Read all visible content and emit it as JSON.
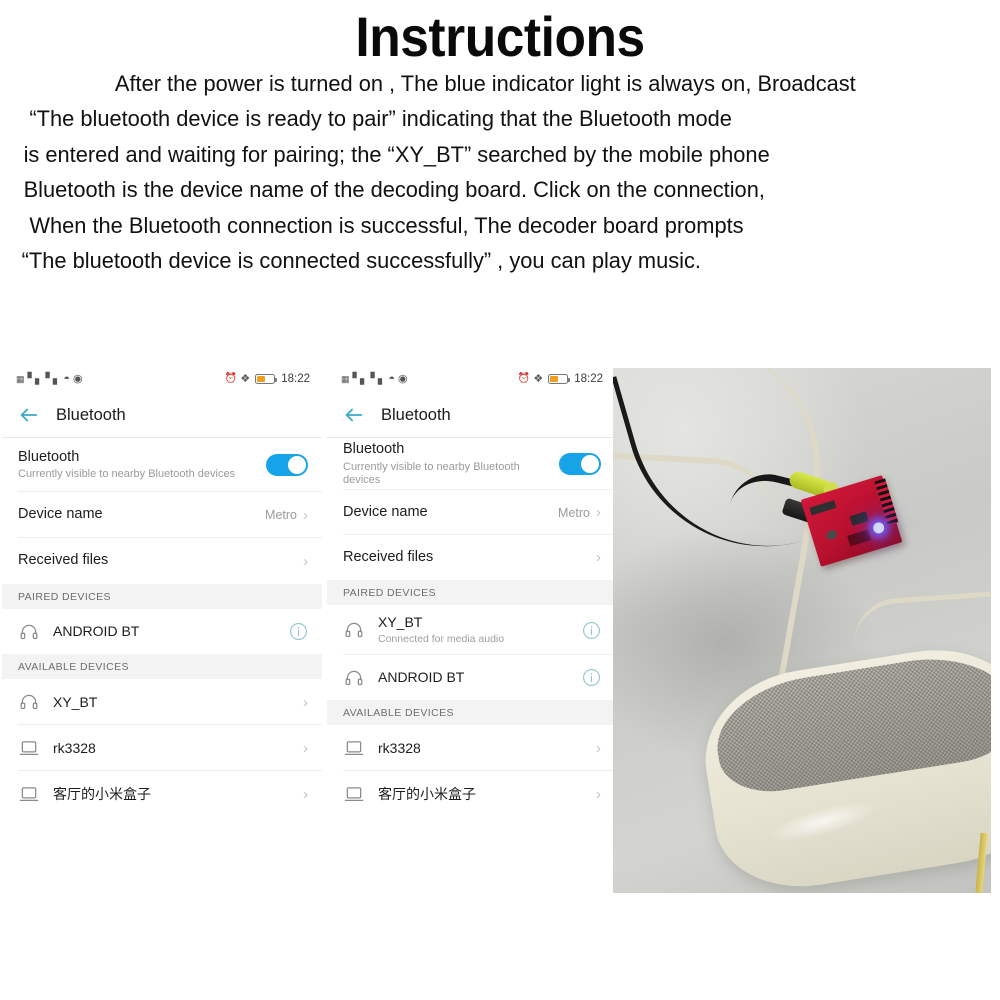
{
  "instructions": {
    "title": "Instructions",
    "lines": [
      "After the power is turned on , The blue indicator light is always on, Broadcast",
      "“The bluetooth device is  ready to pair”   indicating that the Bluetooth mode",
      "is entered and waiting for pairing; the   “XY_BT”   searched by the mobile phone",
      "Bluetooth is the device name of the decoding board. Click on the connection,",
      "When the Bluetooth connection is successful, The decoder board prompts",
      "“The bluetooth device is connected successfully” , you can play music."
    ]
  },
  "colors": {
    "toggle_on": "#17a3e8",
    "back_arrow": "#3aa9c9",
    "info_icon": "#8fc4cc",
    "battery_fill": "#f0a020",
    "section_bg": "#f3f3f3",
    "board_red": "#c8142f",
    "led_blue": "#6e5aff"
  },
  "phone1": {
    "statusbar": {
      "icons_left": [
        "sim-card-icon",
        "signal-bars-icon",
        "signal-bars-icon",
        "wifi-icon",
        "eye-icon"
      ],
      "icons_right": [
        "alarm-clock-icon",
        "bluetooth-icon",
        "battery-icon"
      ],
      "time": "18:22"
    },
    "appbar": {
      "back": "back-arrow-icon",
      "title": "Bluetooth"
    },
    "bluetooth_row": {
      "title": "Bluetooth",
      "subtitle": "Currently visible to nearby Bluetooth devices",
      "toggle_state": "on"
    },
    "device_name_row": {
      "title": "Device name",
      "value": "Metro",
      "chevron": "›"
    },
    "received_files_row": {
      "title": "Received files",
      "chevron": "›"
    },
    "paired_header": "PAIRED DEVICES",
    "paired_devices": [
      {
        "icon": "headphones-icon",
        "name": "ANDROID BT",
        "subtitle": "",
        "trailing": "info-icon"
      }
    ],
    "available_header": "AVAILABLE DEVICES",
    "available_devices": [
      {
        "icon": "headphones-icon",
        "name": "XY_BT",
        "trailing": "chevron-right-icon"
      },
      {
        "icon": "laptop-icon",
        "name": "rk3328",
        "trailing": "chevron-right-icon"
      },
      {
        "icon": "laptop-icon",
        "name": "客厅的小米盒子",
        "trailing": "chevron-right-icon"
      }
    ]
  },
  "phone2": {
    "statusbar": {
      "icons_left": [
        "sim-card-icon",
        "signal-bars-icon",
        "signal-bars-icon",
        "wifi-icon",
        "eye-icon"
      ],
      "icons_right": [
        "alarm-clock-icon",
        "bluetooth-icon",
        "battery-icon"
      ],
      "time": "18:22"
    },
    "appbar": {
      "back": "back-arrow-icon",
      "title": "Bluetooth"
    },
    "bluetooth_row": {
      "title": "Bluetooth",
      "subtitle": "Currently visible to nearby Bluetooth devices",
      "toggle_state": "on"
    },
    "device_name_row": {
      "title": "Device name",
      "value": "Metro",
      "chevron": "›"
    },
    "received_files_row": {
      "title": "Received files",
      "chevron": "›"
    },
    "paired_header": "PAIRED DEVICES",
    "paired_devices": [
      {
        "icon": "headphones-icon",
        "name": "XY_BT",
        "subtitle": "Connected for media audio",
        "trailing": "info-icon"
      },
      {
        "icon": "headphones-icon",
        "name": "ANDROID BT",
        "subtitle": "",
        "trailing": "info-icon"
      }
    ],
    "available_header": "AVAILABLE DEVICES",
    "available_devices": [
      {
        "icon": "laptop-icon",
        "name": "rk3328",
        "trailing": "chevron-right-icon"
      },
      {
        "icon": "laptop-icon",
        "name": "客厅的小米盒子",
        "trailing": "chevron-right-icon"
      }
    ]
  },
  "photo": {
    "description": "Red bluetooth decoder board with glowing blue indicator LED, connected by black and yellow RCA cables, resting above a white speaker with grey mesh grille"
  }
}
